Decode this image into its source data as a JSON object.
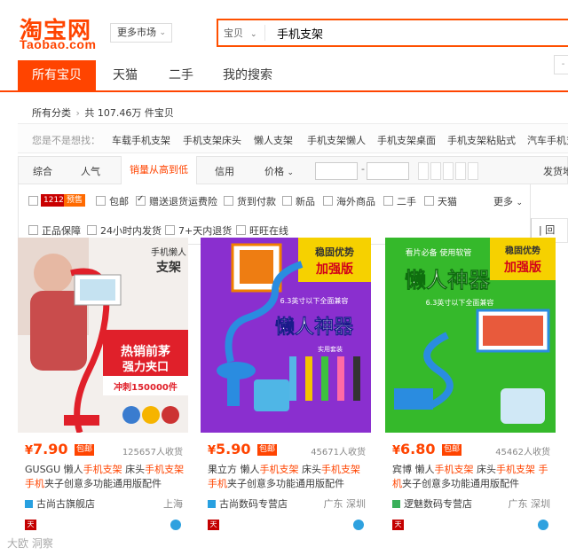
{
  "colors": {
    "brand": "#ff4400",
    "price": "#ff4400",
    "highlight": "#ff4400",
    "link_icon": "#28a0e0"
  },
  "header": {
    "logo_cn": "淘宝网",
    "logo_en": "Taobao.com",
    "market_label": "更多市场",
    "search_category": "宝贝",
    "search_query": "手机支架"
  },
  "nav": {
    "tabs": [
      {
        "label": "所有宝贝",
        "active": true
      },
      {
        "label": "天猫"
      },
      {
        "label": "二手"
      },
      {
        "label": "我的搜索"
      }
    ]
  },
  "breadcrumb": {
    "root": "所有分类",
    "count_text": "共 107.46万 件宝贝"
  },
  "suggest": {
    "label": "您是不是想找：",
    "items": [
      "车载手机支架",
      "手机支架床头",
      "懒人支架",
      "手机支架懒人",
      "手机支架桌面",
      "手机支架粘贴式",
      "汽车手机支"
    ]
  },
  "sort": {
    "items": [
      "综合",
      "人气",
      "销量从高到低",
      "信用",
      "价格"
    ],
    "active_index": 2,
    "price_dash": "-",
    "ship_from": "发货地"
  },
  "filters": {
    "row1": [
      {
        "label": "包邮",
        "checked": false
      },
      {
        "label": "赠送退货运费险",
        "checked": true
      },
      {
        "label": "货到付款",
        "checked": false
      },
      {
        "label": "新品",
        "checked": false
      },
      {
        "label": "海外商品",
        "checked": false
      },
      {
        "label": "二手",
        "checked": false
      },
      {
        "label": "天猫",
        "checked": false
      }
    ],
    "badge_1212": "1212",
    "badge_pre": "预售",
    "more": "更多",
    "row2": [
      {
        "label": "正品保障",
        "checked": false
      },
      {
        "label": "24小时内发货",
        "checked": false
      },
      {
        "label": "7+天内退货",
        "checked": false
      },
      {
        "label": "旺旺在线",
        "checked": false
      }
    ],
    "right_text": "| 回"
  },
  "products": [
    {
      "price": "7.90",
      "tag": "包邮",
      "sales": "125657人收货",
      "title_parts": [
        "GUSGU 懒人",
        "手机支架",
        " 床头",
        "手机支架",
        "",
        "手机",
        "夹子创意多功能通用版配件"
      ],
      "shop": "古尚古旗舰店",
      "loc": "上海",
      "img_text": {
        "corner": "手机懒人",
        "corner2": "支架",
        "line1": "热销前茅",
        "line2": "强力夹口",
        "line3": "冲刺150000件"
      }
    },
    {
      "price": "5.90",
      "tag": "包邮",
      "sales": "45671人收货",
      "title_parts": [
        "果立方 懒人",
        "手机支架",
        " 床头",
        "手机支架",
        "手",
        "机",
        "夹子创意多功能通用版配件"
      ],
      "shop": "古尚数码专营店",
      "loc": "广东 深圳",
      "img_text": {
        "corner": "稳固优势",
        "corner2": "加强版",
        "line1": "6.3英寸以下全面兼容",
        "line2": "懒人神器",
        "line3": "实用套装"
      }
    },
    {
      "price": "6.80",
      "tag": "包邮",
      "sales": "45462人收货",
      "title_parts": [
        "宾博 懒人",
        "手机支架",
        " 床头",
        "手机支架",
        " 手",
        "机",
        "夹子创意多功能通用版配件"
      ],
      "shop": "逻魅数码专营店",
      "loc": "广东 深圳",
      "img_text": {
        "corner": "稳固优势",
        "corner2": "加强版",
        "line1": "看片必备 使用软管",
        "line2": "懒人神器",
        "line3": "6.3英寸以下全面兼容"
      }
    }
  ],
  "currency": "¥",
  "watermark": "大欧 洞察"
}
